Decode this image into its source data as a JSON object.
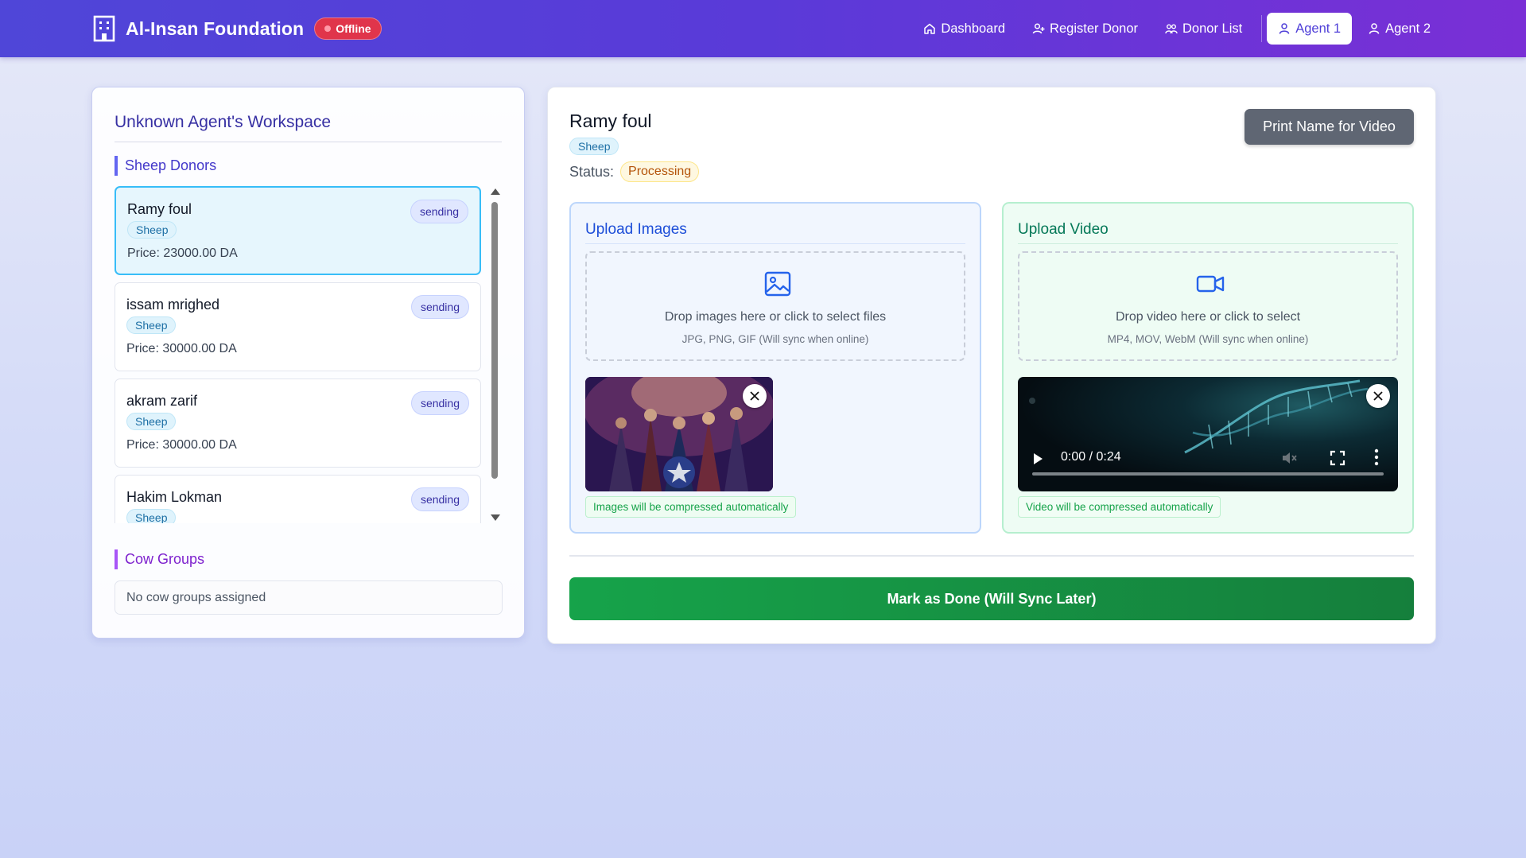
{
  "header": {
    "brand_title": "Al-Insan Foundation",
    "offline_label": "Offline",
    "nav": [
      {
        "label": "Dashboard",
        "icon": "home-icon"
      },
      {
        "label": "Register Donor",
        "icon": "user-plus-icon"
      },
      {
        "label": "Donor List",
        "icon": "users-icon"
      },
      {
        "label": "Agent 1",
        "icon": "user-icon",
        "active": true
      },
      {
        "label": "Agent 2",
        "icon": "user-icon"
      }
    ]
  },
  "workspace": {
    "title": "Unknown Agent's Workspace",
    "sheep_section_title": "Sheep Donors",
    "donors": [
      {
        "name": "Ramy foul",
        "type": "Sheep",
        "price": "Price: 23000.00 DA",
        "status": "sending",
        "selected": true
      },
      {
        "name": "issam mrighed",
        "type": "Sheep",
        "price": "Price: 30000.00 DA",
        "status": "sending"
      },
      {
        "name": "akram zarif",
        "type": "Sheep",
        "price": "Price: 30000.00 DA",
        "status": "sending"
      },
      {
        "name": "Hakim Lokman",
        "type": "Sheep",
        "price": "",
        "status": "sending"
      }
    ],
    "cow_section_title": "Cow Groups",
    "cow_empty_text": "No cow groups assigned"
  },
  "detail": {
    "donor_name": "Ramy foul",
    "type": "Sheep",
    "status_label": "Status:",
    "status_value": "Processing",
    "print_button": "Print Name for Video",
    "images": {
      "title": "Upload Images",
      "drop_text": "Drop images here or click to select files",
      "drop_sub": "JPG, PNG, GIF (Will sync when online)",
      "compress_note": "Images will be compressed automatically"
    },
    "video": {
      "title": "Upload Video",
      "drop_text": "Drop video here or click to select",
      "drop_sub": "MP4, MOV, WebM (Will sync when online)",
      "time": "0:00 / 0:24",
      "compress_note": "Video will be compressed automatically"
    },
    "done_button": "Mark as Done (Will Sync Later)"
  },
  "colors": {
    "nav_gradient_start": "#4f46d8",
    "nav_gradient_end": "#7a2fd6",
    "offline_red": "#e0354b",
    "done_green": "#16a34a",
    "print_gray": "#5f6673"
  }
}
